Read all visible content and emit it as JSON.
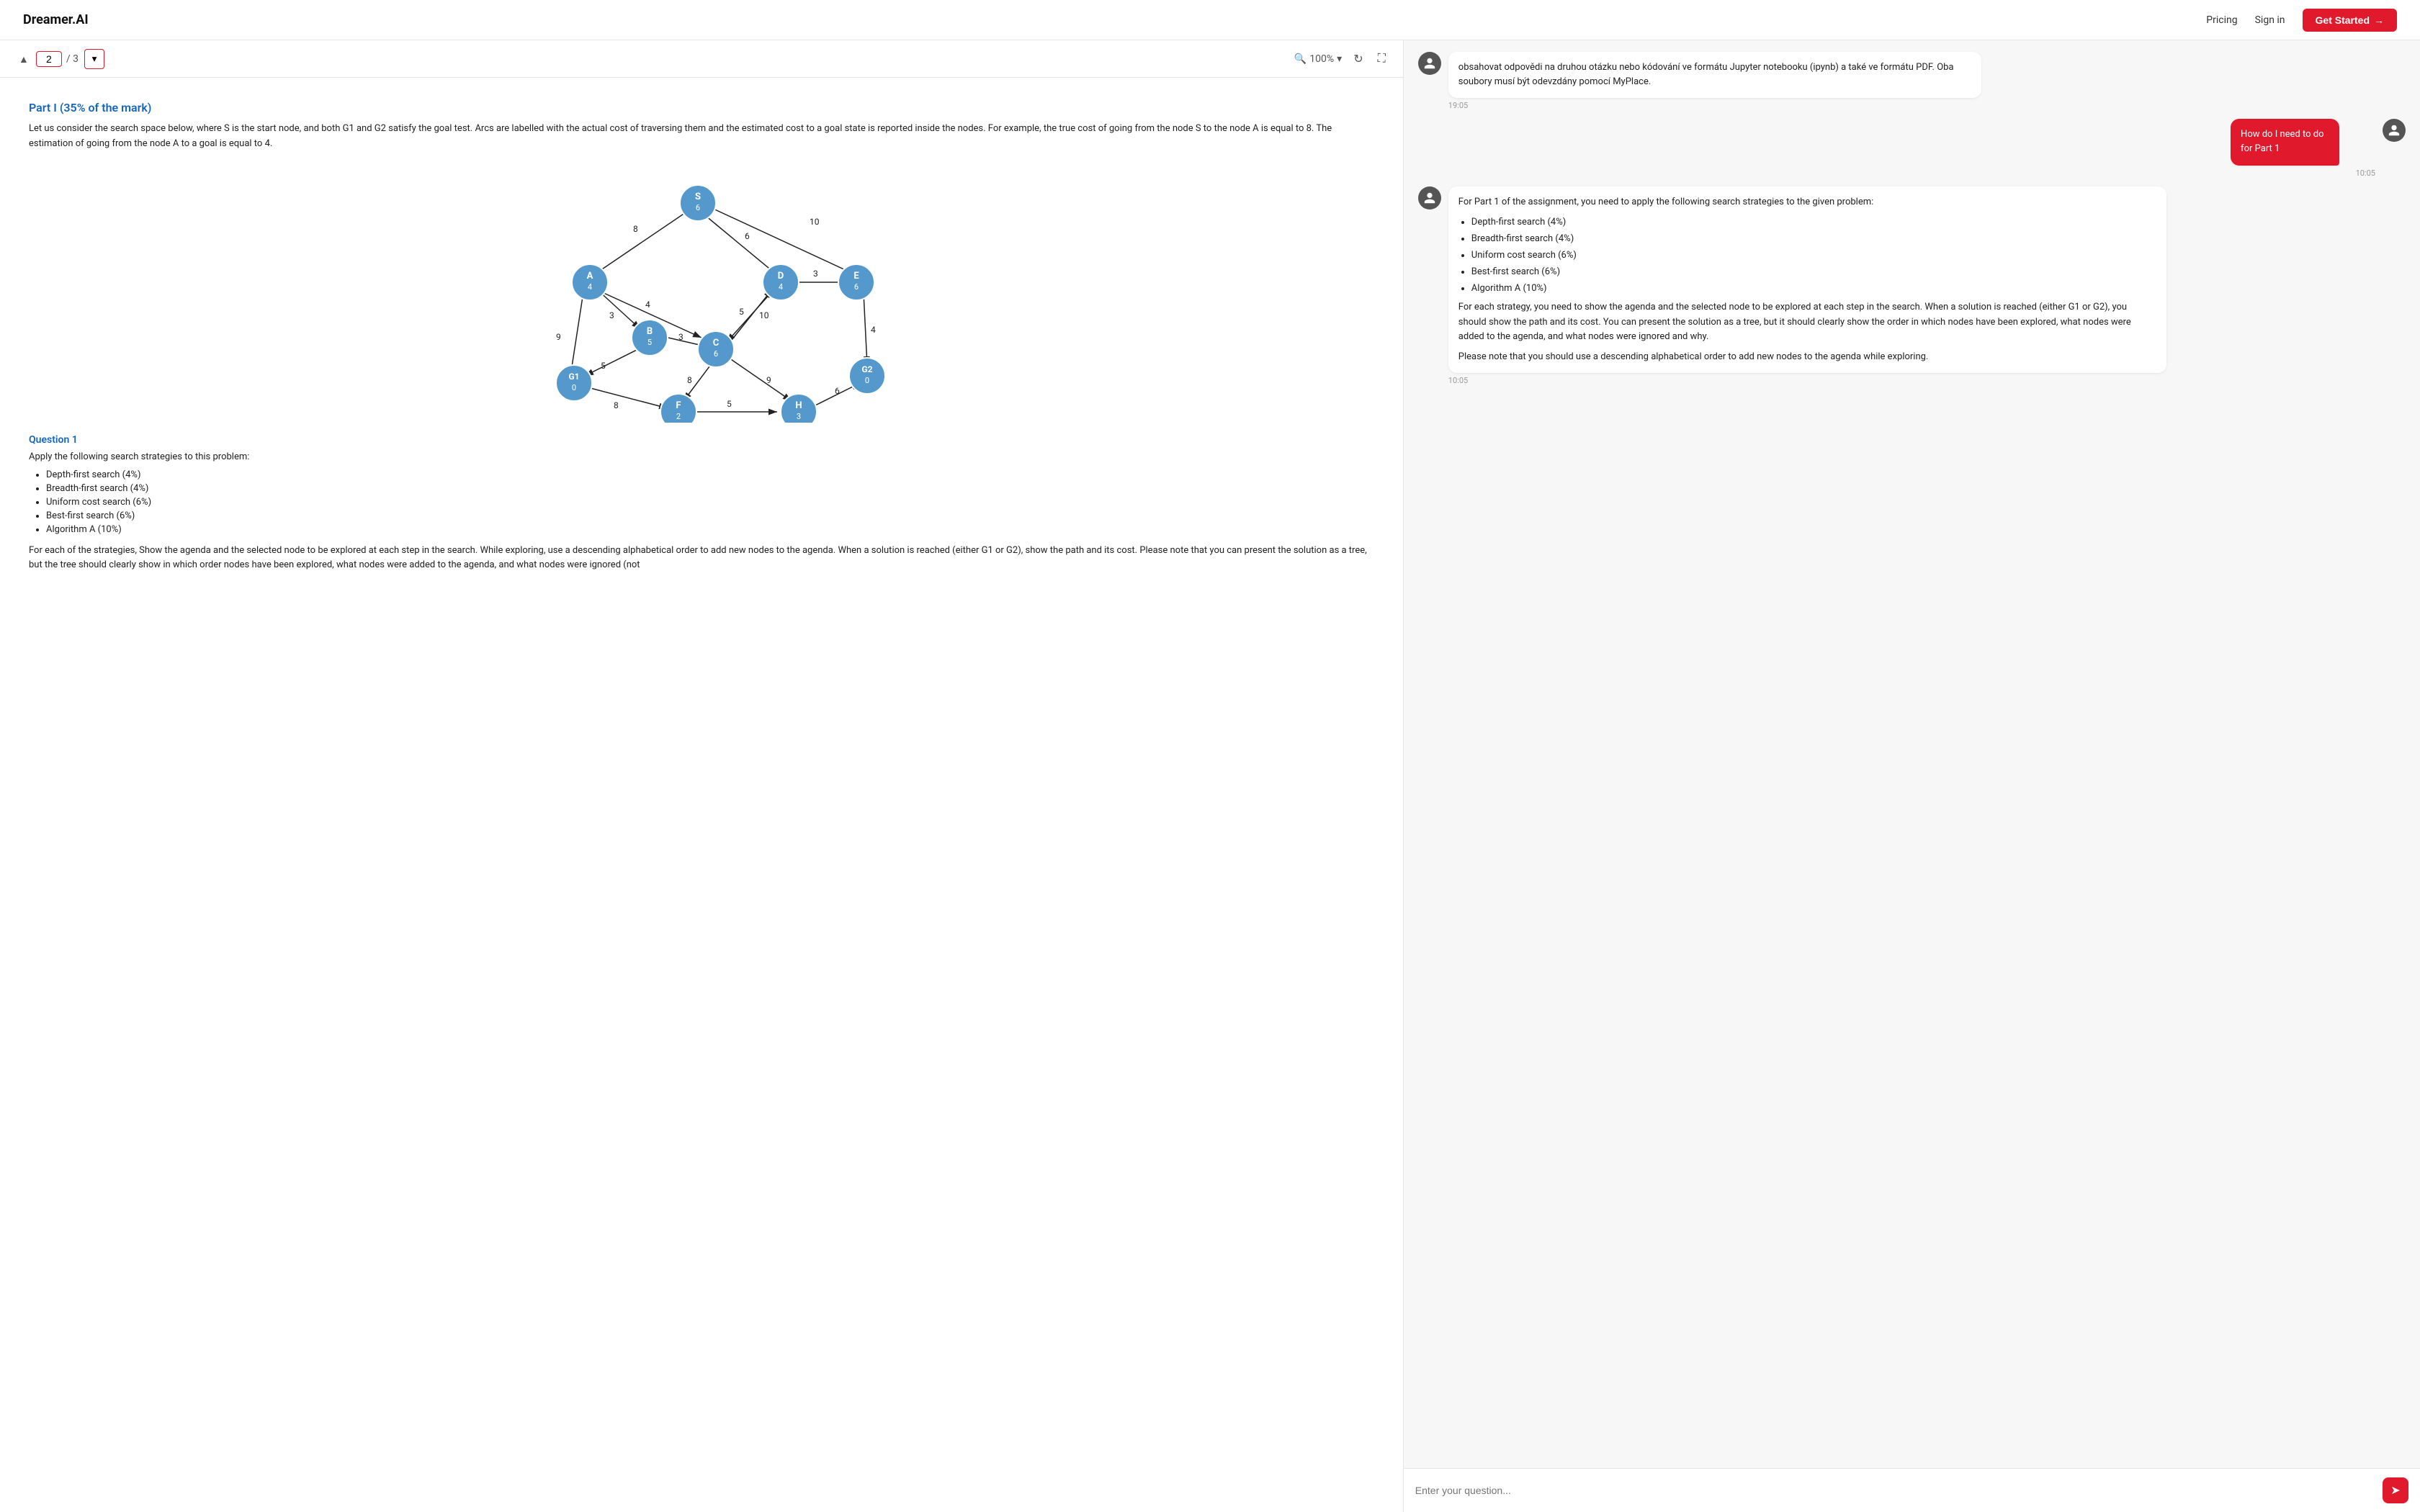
{
  "nav": {
    "logo": "Dreamer.AI",
    "pricing": "Pricing",
    "signin": "Sign in",
    "get_started": "Get Started"
  },
  "pdf": {
    "current_page": "2",
    "total_pages": "/ 3",
    "zoom": "100%",
    "part_title": "Part I (35% of the mark)",
    "part_description": "Let us consider the search space below, where S is the start node, and both G1 and G2 satisfy the goal test. Arcs are labelled with the actual cost of traversing them and the estimated cost to a goal state is reported inside the nodes. For example, the true cost of going from the node S to the node A is equal to 8. The estimation of going from the node A to a goal is equal to 4.",
    "question_title": "Question 1",
    "question_text": "Apply the following search strategies to this problem:",
    "strategies": [
      "Depth-first search (4%)",
      "Breadth-first search (4%)",
      "Uniform cost search (6%)",
      "Best-first search (6%)",
      "Algorithm A (10%)"
    ],
    "additional_text": "For each of the strategies, Show the agenda and the selected node to be explored at each step in the search. While exploring, use a descending alphabetical order to add new nodes to the agenda. When a solution is reached (either G1 or G2), show the path and its cost. Please note that you can present the solution as a tree, but the tree should clearly show in which order nodes have been explored, what nodes were added to the agenda, and what nodes were ignored (not"
  },
  "chat": {
    "messages": [
      {
        "id": "msg1",
        "type": "assistant",
        "text_lines": [
          "obsahovat odpovědi na druhou otázku nebo kódování ve formátu Jupyter notebooku (ipynb) a také ve formátu PDF. Oba soubory musí být odevzdány pomocí MyPlace."
        ],
        "time": "19:05"
      },
      {
        "id": "msg2",
        "type": "user",
        "text": "How do I need to do for Part 1",
        "time": "10:05"
      },
      {
        "id": "msg3",
        "type": "assistant",
        "intro": "For Part 1 of the assignment, you need to apply the following search strategies to the given problem:",
        "strategies": [
          "Depth-first search (4%)",
          "Breadth-first search (4%)",
          "Uniform cost search (6%)",
          "Best-first search (6%)",
          "Algorithm A (10%)"
        ],
        "body1": "For each strategy, you need to show the agenda and the selected node to be explored at each step in the search. When a solution is reached (either G1 or G2), you should show the path and its cost. You can present the solution as a tree, but it should clearly show the order in which nodes have been explored, what nodes were added to the agenda, and what nodes were ignored and why.",
        "body2": "Please note that you should use a descending alphabetical order to add new nodes to the agenda while exploring.",
        "time": "10:05"
      }
    ],
    "input_placeholder": "Enter your question..."
  },
  "icons": {
    "chevron_up": "▲",
    "chevron_down": "▼",
    "search": "🔍",
    "refresh": "↻",
    "fullscreen": "⛶",
    "send": "➤",
    "dropdown_arrow": "▾"
  }
}
